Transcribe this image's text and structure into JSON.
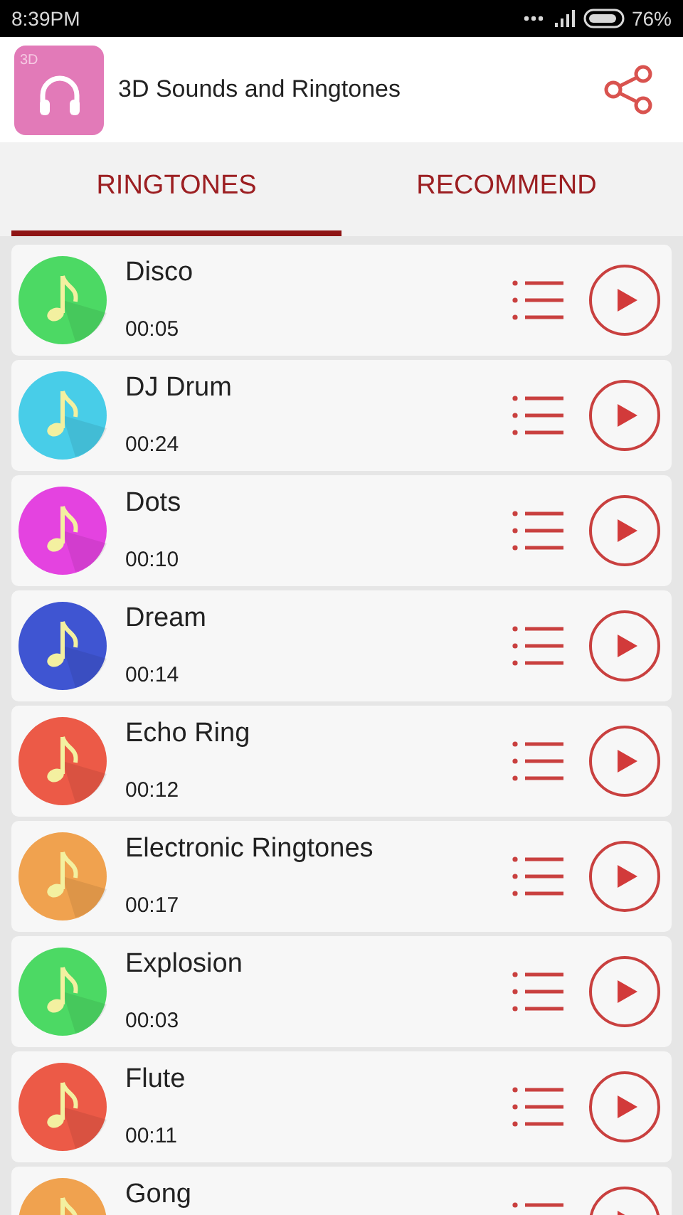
{
  "status_bar": {
    "time": "8:39PM",
    "battery": "76%"
  },
  "app_bar": {
    "title": "3D Sounds and Ringtones",
    "logo_text": "3D"
  },
  "tabs": [
    {
      "label": "RINGTONES",
      "selected": true
    },
    {
      "label": "RECOMMEND",
      "selected": false
    }
  ],
  "ringtones": [
    {
      "name": "Disco",
      "duration": "00:05",
      "color": "#4cd964"
    },
    {
      "name": "DJ Drum",
      "duration": "00:24",
      "color": "#48cde8"
    },
    {
      "name": "Dots",
      "duration": "00:10",
      "color": "#e443e0"
    },
    {
      "name": "Dream",
      "duration": "00:14",
      "color": "#3f55d2"
    },
    {
      "name": "Echo Ring",
      "duration": "00:12",
      "color": "#ec5a47"
    },
    {
      "name": "Electronic Ringtones",
      "duration": "00:17",
      "color": "#f0a24f"
    },
    {
      "name": "Explosion",
      "duration": "00:03",
      "color": "#4cd964"
    },
    {
      "name": "Flute",
      "duration": "00:11",
      "color": "#ec5a47"
    },
    {
      "name": "Gong",
      "color": "#f0a24f"
    }
  ]
}
